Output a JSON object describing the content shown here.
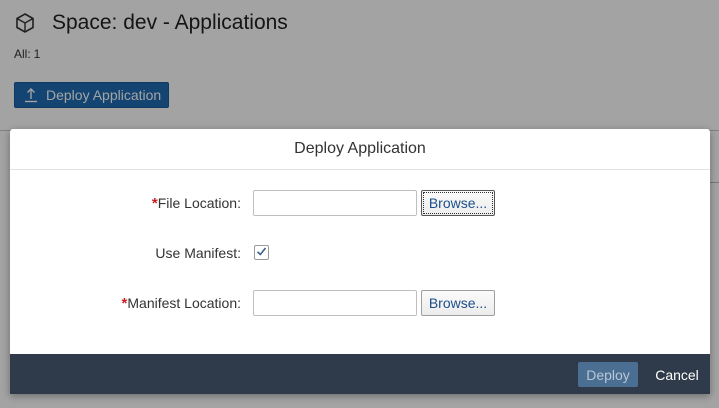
{
  "page": {
    "title": "Space: dev - Applications",
    "count_label": "All:",
    "count_value": "1",
    "deploy_button_label": "Deploy Application"
  },
  "dialog": {
    "title": "Deploy Application",
    "fields": {
      "file_location": {
        "required_mark": "*",
        "label": "File Location:",
        "value": "",
        "browse_label": "Browse..."
      },
      "use_manifest": {
        "label": "Use Manifest:",
        "checked": true
      },
      "manifest_location": {
        "required_mark": "*",
        "label": "Manifest Location:",
        "value": "",
        "browse_label": "Browse..."
      }
    },
    "footer": {
      "deploy_label": "Deploy",
      "cancel_label": "Cancel"
    }
  },
  "colors": {
    "primary_button": "#1f6bb3",
    "footer_bg": "#2f3b4a",
    "required": "#cc1e1e"
  },
  "icons": {
    "space": "hexagon-cube-icon",
    "deploy": "upload-icon",
    "check": "checkmark-icon"
  }
}
